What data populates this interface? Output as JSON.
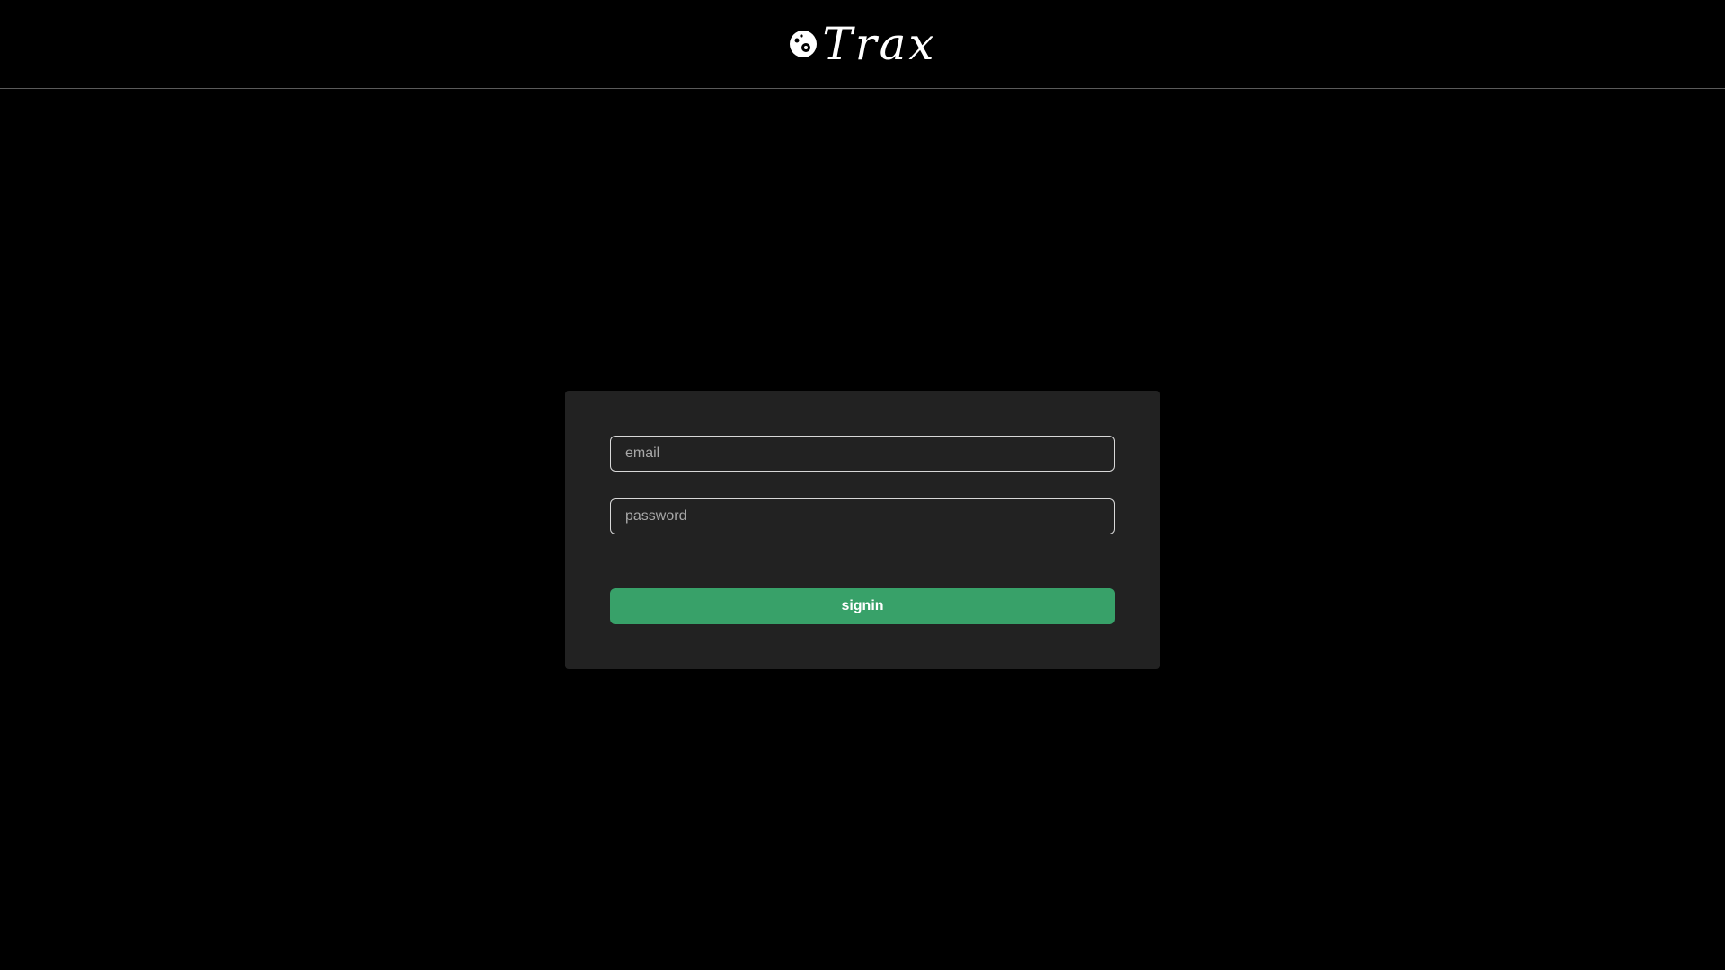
{
  "header": {
    "logo_text": "Trax",
    "logo_icon": "vinyl-record-icon"
  },
  "form": {
    "email_placeholder": "email",
    "email_value": "",
    "password_placeholder": "password",
    "password_value": "",
    "submit_label": "signin"
  },
  "colors": {
    "background": "#000000",
    "card": "#222222",
    "accent": "#38a169",
    "divider": "#5a5a5a"
  }
}
